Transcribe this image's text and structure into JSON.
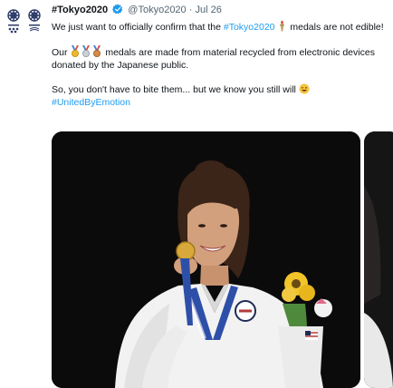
{
  "tweet": {
    "display_name": "#Tokyo2020",
    "handle": "@Tokyo2020",
    "separator": "·",
    "date": "Jul 26",
    "line1_before": "We just want to officially confirm that the ",
    "hashtag_inline": "#Tokyo2020",
    "line1_after": " medals are not edible!",
    "para2_before": "Our ",
    "para2_after": " medals are made from material recycled from electronic devices donated by the Japanese public.",
    "para3": "So, you don't have to bite them... but we know you still will ",
    "hashtag_footer": "#UnitedByEmotion"
  },
  "icons": [
    "olympic-paralympic-logo-icon",
    "verified-badge-icon",
    "torch-emoji-icon",
    "gold-medal-emoji-icon",
    "silver-medal-emoji-icon",
    "bronze-medal-emoji-icon",
    "grin-emoji-icon"
  ],
  "colors": {
    "link": "#1d9bf0",
    "verified": "#1d9bf0",
    "muted": "#536471"
  }
}
